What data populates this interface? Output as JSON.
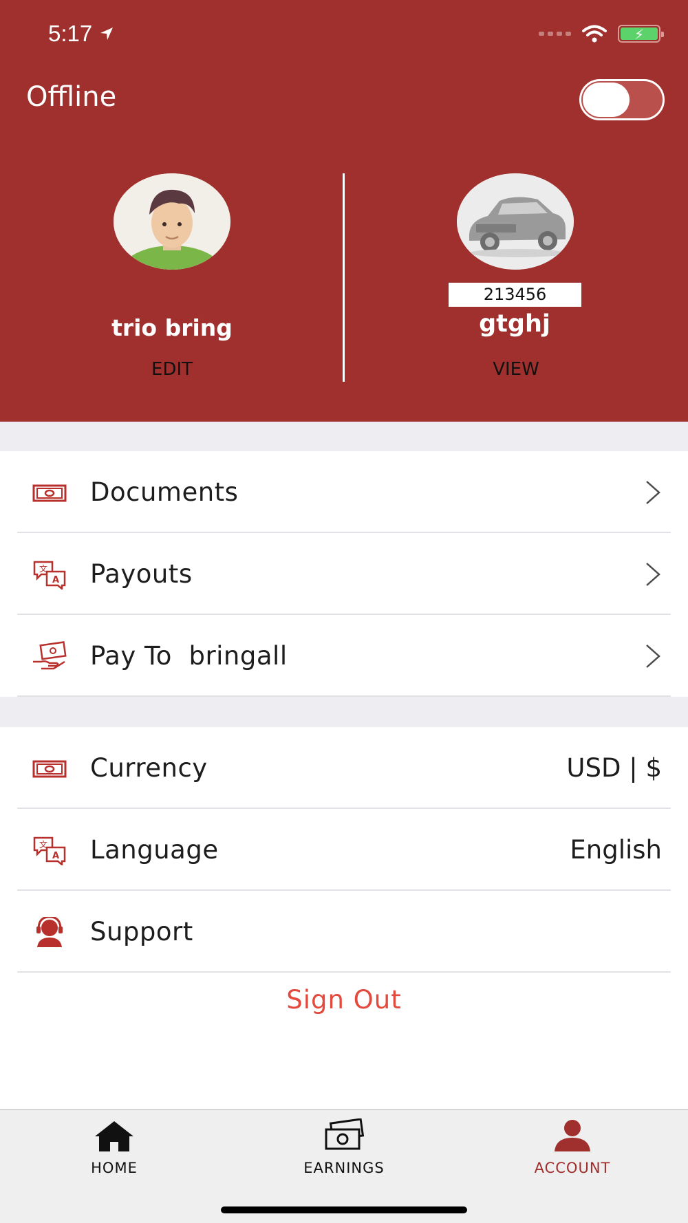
{
  "status_bar": {
    "time": "5:17"
  },
  "header": {
    "status_label": "Offline",
    "toggle_state": "off",
    "user": {
      "name": "trio bring",
      "edit_label": "EDIT"
    },
    "vehicle": {
      "number": "213456",
      "name": "gtghj",
      "view_label": "VIEW"
    }
  },
  "menu": {
    "items": [
      {
        "label": "Documents",
        "icon": "money-icon"
      },
      {
        "label": "Payouts",
        "icon": "language-icon"
      },
      {
        "label": "Pay To  bringall",
        "icon": "payment-hand-icon"
      }
    ]
  },
  "settings": {
    "items": [
      {
        "label": "Currency",
        "value": "USD | $",
        "icon": "money-icon"
      },
      {
        "label": "Language",
        "value": "English",
        "icon": "language-icon"
      },
      {
        "label": "Support",
        "icon": "headset-icon"
      }
    ],
    "signout_label": "Sign Out"
  },
  "tabbar": {
    "tabs": [
      {
        "label": "HOME",
        "icon": "home-icon",
        "active": false
      },
      {
        "label": "EARNINGS",
        "icon": "cash-icon",
        "active": false
      },
      {
        "label": "ACCOUNT",
        "icon": "person-icon",
        "active": true
      }
    ]
  },
  "colors": {
    "brand": "#a0302d",
    "signout": "#e34a3d",
    "icon": "#b8302c"
  }
}
